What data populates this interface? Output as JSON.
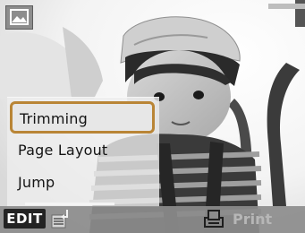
{
  "menu": {
    "items": [
      {
        "label": "Trimming",
        "selected": true
      },
      {
        "label": "Page Layout",
        "selected": false
      },
      {
        "label": "Jump",
        "selected": false
      }
    ]
  },
  "bottom_bar": {
    "edit_label": "EDIT",
    "print_label": "Print",
    "print_enabled": false
  },
  "icons": {
    "top_left": "photo-mode-icon",
    "edit_list": "list-return-icon",
    "print": "print-icon"
  },
  "colors": {
    "selection_border": "#b98536",
    "bottom_bar": "#8c8c8c",
    "edit_button": "#232323",
    "disabled_text": "#b7b7b7"
  }
}
